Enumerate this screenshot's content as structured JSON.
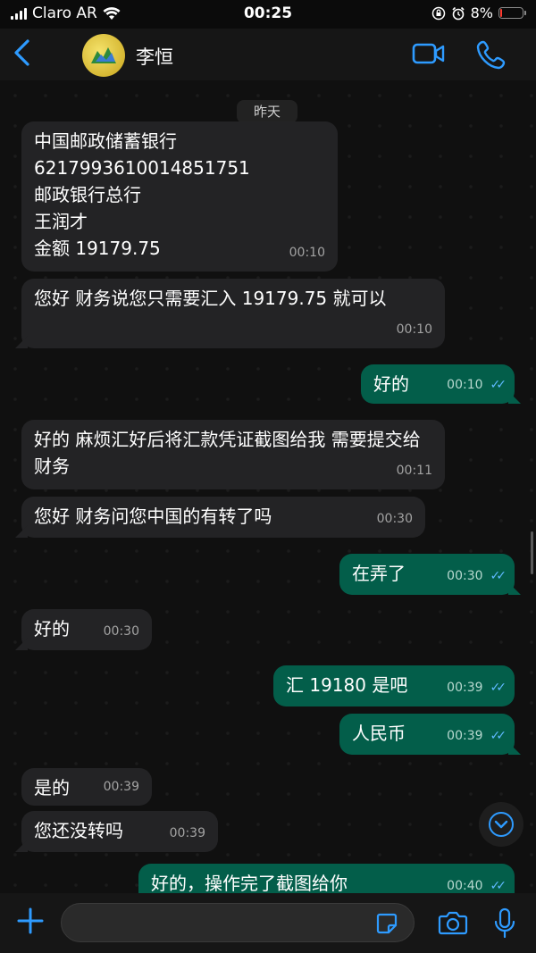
{
  "status": {
    "carrier": "Claro AR",
    "time": "00:25",
    "battery": "8%",
    "battery_level": 0.08
  },
  "header": {
    "contact_name": "李恒",
    "icons": [
      "back-icon",
      "avatar",
      "video-call-icon",
      "phone-call-icon"
    ]
  },
  "chat": {
    "date_chip": "昨天",
    "messages": [
      {
        "dir": "in",
        "text": "中国邮政储蓄银行\n6217993610014851751\n邮政银行总行\n王润才\n金额 19179.75",
        "time": "00:10"
      },
      {
        "dir": "in",
        "text": "您好 财务说您只需要汇入 19179.75 就可以",
        "time": "00:10"
      },
      {
        "dir": "out",
        "text": "好的",
        "time": "00:10",
        "read": true
      },
      {
        "dir": "in",
        "text": "好的 麻烦汇好后将汇款凭证截图给我 需要提交给财务",
        "time": "00:11"
      },
      {
        "dir": "in",
        "text": "您好 财务问您中国的有转了吗",
        "time": "00:30"
      },
      {
        "dir": "out",
        "text": "在弄了",
        "time": "00:30",
        "read": true
      },
      {
        "dir": "in",
        "text": "好的",
        "time": "00:30"
      },
      {
        "dir": "out",
        "text": "汇 19180 是吧",
        "time": "00:39",
        "read": true
      },
      {
        "dir": "out",
        "text": "人民币",
        "time": "00:39",
        "read": true
      },
      {
        "dir": "in",
        "text": "是的",
        "time": "00:39"
      },
      {
        "dir": "in",
        "text": "您还没转吗",
        "time": "00:39"
      },
      {
        "dir": "out",
        "text": "好的，操作完了截图给你",
        "time": "00:40",
        "read": true
      }
    ]
  },
  "input": {
    "placeholder": "",
    "icons": [
      "plus-icon",
      "sticker-icon",
      "camera-icon",
      "microphone-icon"
    ]
  },
  "colors": {
    "accent": "#2e9bff",
    "incoming_bubble": "#232325",
    "outgoing_bubble": "#035e4a",
    "read_ticks": "#5fb9ff"
  }
}
